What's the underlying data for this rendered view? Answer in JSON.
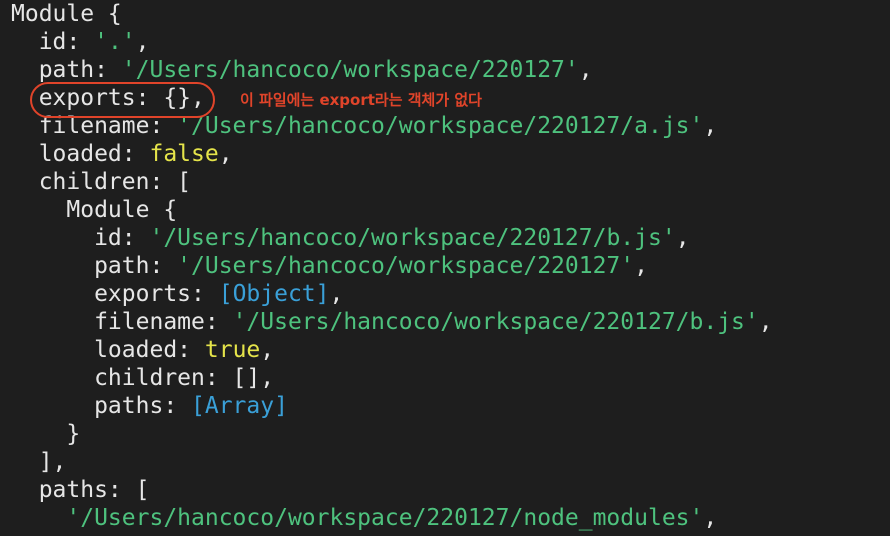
{
  "terminal": {
    "lines": [
      {
        "i": 0,
        "parts": [
          {
            "t": "Module {",
            "c": "k"
          }
        ]
      },
      {
        "i": 1,
        "parts": [
          {
            "t": "  id: ",
            "c": "k"
          },
          {
            "t": "'.'",
            "c": "str"
          },
          {
            "t": ",",
            "c": "k"
          }
        ]
      },
      {
        "i": 2,
        "parts": [
          {
            "t": "  path: ",
            "c": "k"
          },
          {
            "t": "'/Users/hancoco/workspace/220127'",
            "c": "str"
          },
          {
            "t": ",",
            "c": "k"
          }
        ]
      },
      {
        "i": 3,
        "parts": [
          {
            "t": "  exports: {},",
            "c": "k"
          }
        ]
      },
      {
        "i": 4,
        "parts": [
          {
            "t": "  filename: ",
            "c": "k"
          },
          {
            "t": "'/Users/hancoco/workspace/220127/a.js'",
            "c": "str"
          },
          {
            "t": ",",
            "c": "k"
          }
        ]
      },
      {
        "i": 5,
        "parts": [
          {
            "t": "  loaded: ",
            "c": "k"
          },
          {
            "t": "false",
            "c": "bool"
          },
          {
            "t": ",",
            "c": "k"
          }
        ]
      },
      {
        "i": 6,
        "parts": [
          {
            "t": "  children: [",
            "c": "k"
          }
        ]
      },
      {
        "i": 7,
        "parts": [
          {
            "t": "    Module {",
            "c": "k"
          }
        ]
      },
      {
        "i": 8,
        "parts": [
          {
            "t": "      id: ",
            "c": "k"
          },
          {
            "t": "'/Users/hancoco/workspace/220127/b.js'",
            "c": "str"
          },
          {
            "t": ",",
            "c": "k"
          }
        ]
      },
      {
        "i": 9,
        "parts": [
          {
            "t": "      path: ",
            "c": "k"
          },
          {
            "t": "'/Users/hancoco/workspace/220127'",
            "c": "str"
          },
          {
            "t": ",",
            "c": "k"
          }
        ]
      },
      {
        "i": 10,
        "parts": [
          {
            "t": "      exports: ",
            "c": "k"
          },
          {
            "t": "[Object]",
            "c": "ref"
          },
          {
            "t": ",",
            "c": "k"
          }
        ]
      },
      {
        "i": 11,
        "parts": [
          {
            "t": "      filename: ",
            "c": "k"
          },
          {
            "t": "'/Users/hancoco/workspace/220127/b.js'",
            "c": "str"
          },
          {
            "t": ",",
            "c": "k"
          }
        ]
      },
      {
        "i": 12,
        "parts": [
          {
            "t": "      loaded: ",
            "c": "k"
          },
          {
            "t": "true",
            "c": "bool"
          },
          {
            "t": ",",
            "c": "k"
          }
        ]
      },
      {
        "i": 13,
        "parts": [
          {
            "t": "      children: [],",
            "c": "k"
          }
        ]
      },
      {
        "i": 14,
        "parts": [
          {
            "t": "      paths: ",
            "c": "k"
          },
          {
            "t": "[Array]",
            "c": "ref"
          }
        ]
      },
      {
        "i": 15,
        "parts": [
          {
            "t": "    }",
            "c": "k"
          }
        ]
      },
      {
        "i": 16,
        "parts": [
          {
            "t": "  ],",
            "c": "k"
          }
        ]
      },
      {
        "i": 17,
        "parts": [
          {
            "t": "  paths: [",
            "c": "k"
          }
        ]
      },
      {
        "i": 18,
        "parts": [
          {
            "t": "    ",
            "c": "k"
          },
          {
            "t": "'/Users/hancoco/workspace/220127/node_modules'",
            "c": "str"
          },
          {
            "t": ",",
            "c": "k"
          }
        ]
      }
    ]
  },
  "annotation": {
    "text": "이 파일에는 export라는 객체가 없다"
  },
  "colors": {
    "background": "#1e1e1e",
    "text": "#e6e6e6",
    "string": "#4ec27e",
    "boolean": "#e5e44a",
    "reference": "#3aa0d8",
    "annotation": "#e0442a"
  }
}
